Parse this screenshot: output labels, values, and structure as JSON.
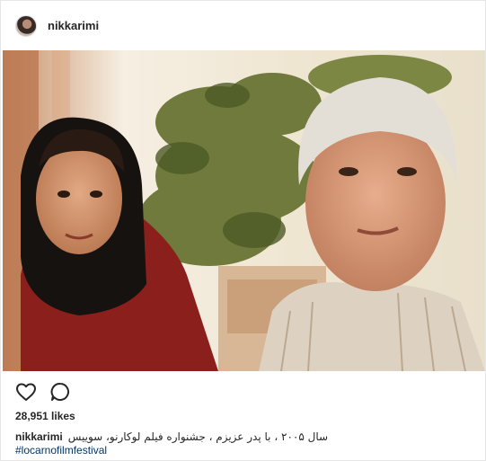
{
  "post": {
    "username": "nikkarimi",
    "avatar_icon": "profile-avatar",
    "actions": {
      "like_icon": "heart-outline-icon",
      "comment_icon": "comment-bubble-icon"
    },
    "likes": "28,951 likes",
    "caption": {
      "username": "nikkarimi",
      "text": "سال ۲۰۰۵ ، با پدر عزیزم ، جشنواره فیلم لوکارنو، سوییس",
      "hashtag": "#locarnofilmfestival"
    }
  },
  "colors": {
    "text": "#262626",
    "hashtag": "#003569",
    "border": "#e6e6e6"
  }
}
